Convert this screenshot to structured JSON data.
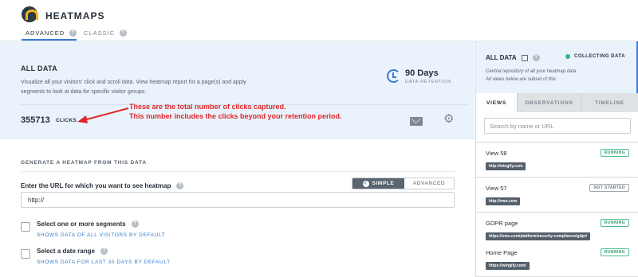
{
  "header": {
    "app_title": "HEATMAPS",
    "tabs": [
      {
        "label": "ADVANCED"
      },
      {
        "label": "CLASSIC"
      }
    ]
  },
  "data_panel": {
    "title": "ALL DATA",
    "description": "Visualize all your visitors' click and scroll data. View heatmap report for a page(s) and apply segments to look at data for specific visitor groups.",
    "retention_value": "90 Days",
    "retention_label": "DATA RETENTION",
    "clicks_value": "355713",
    "clicks_label": "CLICKS",
    "annotation_line1": "These are the total number of clicks captured.",
    "annotation_line2": "This number includes the clicks beyond your retention period."
  },
  "generate": {
    "title": "GENERATE A HEATMAP FROM THIS DATA",
    "url_label": "Enter the URL for which you want to see heatmap",
    "mode_simple": "SIMPLE",
    "mode_advanced": "ADVANCED",
    "url_value": "http://",
    "segments_title": "Select one or more segments",
    "segments_sub": "SHOWS DATA OF ALL VISITORS BY DEFAULT",
    "date_title": "Select a date range",
    "date_sub": "SHOWS DATA FOR LAST 30 DAYS BY DEFAULT"
  },
  "sidebar": {
    "title": "ALL DATA",
    "status": "COLLECTING DATA",
    "status_color": "#2eb87e",
    "repo_line1": "Central repository of all your heatmap data.",
    "repo_line2": "All views below are subset of this",
    "tabs": [
      {
        "label": "VIEWS"
      },
      {
        "label": "OBSERVATIONS"
      },
      {
        "label": "TIMELINE"
      }
    ],
    "search_placeholder": "Search by name or URL",
    "views": [
      {
        "name": "View 58",
        "url": "http://wingify.com",
        "status": "RUNNING"
      },
      {
        "name": "View 57",
        "url": "http://vwo.com",
        "status": "NOT STARTED"
      },
      {
        "name": "GDPR page",
        "url": "https://vwo.com/platform/security-compliance/gdpr/",
        "status": "RUNNING"
      },
      {
        "name": "Home Page",
        "url": "https://wingify.com/",
        "status": "RUNNING"
      }
    ]
  }
}
